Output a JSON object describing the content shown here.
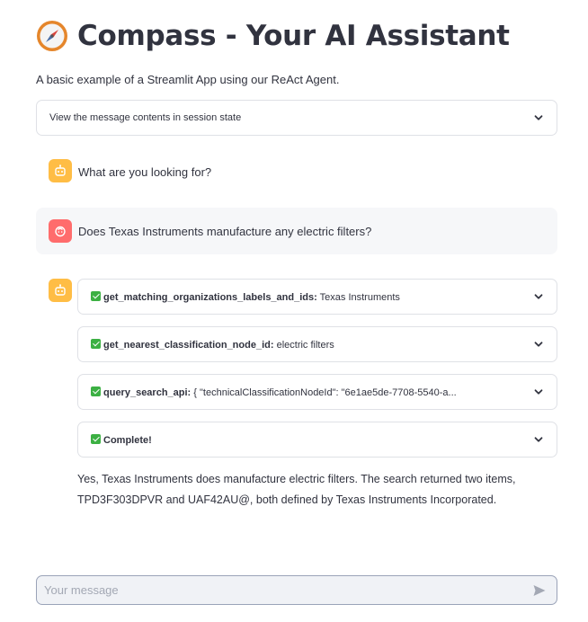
{
  "header": {
    "title": "Compass - Your AI Assistant",
    "subtitle": "A basic example of a Streamlit App using our ReAct Agent."
  },
  "session_expander": {
    "label": "View the message contents in session state"
  },
  "messages": {
    "assistant_greeting": "What are you looking for?",
    "user_question": "Does Texas Instruments manufacture any electric filters?",
    "tool_steps": [
      {
        "name": "get_matching_organizations_labels_and_ids:",
        "detail": "Texas Instruments"
      },
      {
        "name": "get_nearest_classification_node_id:",
        "detail": "electric filters"
      },
      {
        "name": "query_search_api:",
        "detail": "{ \"technicalClassificationNodeId\": \"6e1ae5de-7708-5540-a..."
      },
      {
        "name": "Complete!",
        "detail": ""
      }
    ],
    "answer_line1": "Yes, Texas Instruments does manufacture electric filters. The search returned two items,",
    "answer_line2": "TPD3F303DPVR and UAF42AU@, both defined by Texas Instruments Incorporated."
  },
  "chat_input": {
    "placeholder": "Your message",
    "value": ""
  },
  "icons": {
    "title_icon": "compass-icon",
    "assistant_avatar": "robot-icon",
    "user_avatar": "user-face-icon",
    "expander_toggle": "chevron-down-icon",
    "step_status": "check-mark-icon",
    "send": "send-icon"
  },
  "colors": {
    "assistant_avatar": "#ffbd45",
    "user_avatar": "#ff6c6c",
    "check": "#3cb043",
    "user_bubble": "#f6f7f9",
    "input_bg": "#f0f2f6"
  }
}
